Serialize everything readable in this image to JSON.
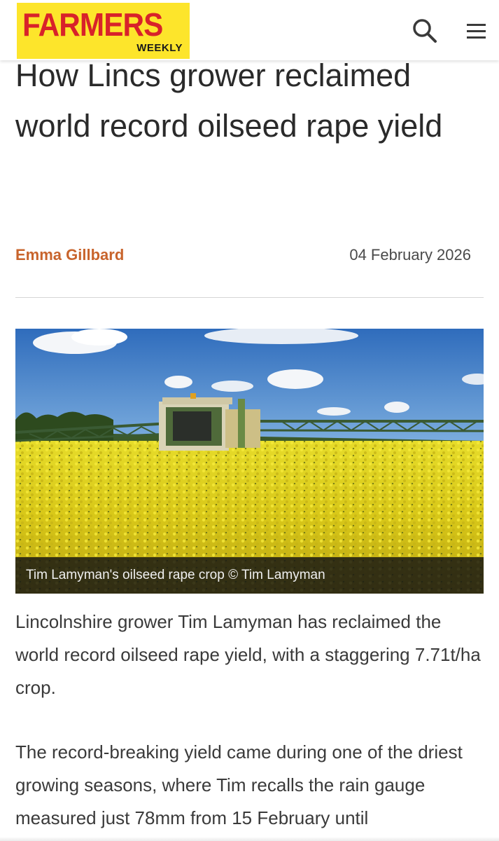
{
  "header": {
    "logo_main": "FARMERS",
    "logo_sub": "WEEKLY",
    "search_icon": "search-icon",
    "menu_icon": "hamburger-menu-icon"
  },
  "article": {
    "title": "How Lincs grower reclaimed world record oilseed rape yield",
    "author": "Emma Gillbard",
    "date": "04 February 2026",
    "image_caption": "Tim Lamyman's oilseed rape crop © Tim Lamyman",
    "paragraphs": [
      "Lincolnshire grower Tim Lamyman has reclaimed the world record oilseed rape yield, with a staggering 7.71t/ha crop.",
      "The record-breaking yield came during one of the driest growing seasons, where Tim recalls the rain gauge measured just 78mm from 15 February until"
    ]
  },
  "colors": {
    "logo_background": "#fde52b",
    "logo_red": "#d8222a",
    "author_orange": "#c8642c",
    "crop_yellow": "#e9d81c",
    "sky_blue": "#3d78c4"
  }
}
